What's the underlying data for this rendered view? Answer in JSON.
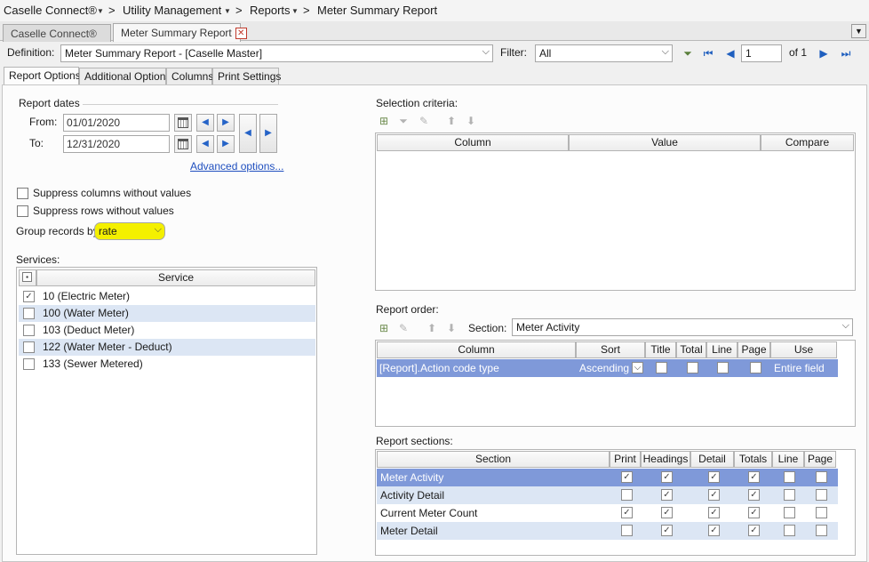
{
  "breadcrumb": {
    "items": [
      "Caselle Connect®",
      "Utility Management",
      "Reports",
      "Meter Summary Report"
    ]
  },
  "doc_tabs": [
    {
      "label": "Caselle Connect®"
    },
    {
      "label": "Meter Summary Report"
    }
  ],
  "definition": {
    "label": "Definition:",
    "value": "Meter Summary Report - [Caselle Master]",
    "filter_label": "Filter:",
    "filter_value": "All",
    "page_value": "1",
    "page_of": "of 1"
  },
  "page_tabs": [
    "Report Options",
    "Additional Options",
    "Columns",
    "Print Settings"
  ],
  "report_dates": {
    "title": "Report dates",
    "from_label": "From:",
    "from_value": "01/01/2020",
    "to_label": "To:",
    "to_value": "12/31/2020",
    "advanced_link": "Advanced options..."
  },
  "options": {
    "suppress_columns": "Suppress columns without values",
    "suppress_rows": "Suppress rows without values",
    "group_label": "Group records by",
    "group_value": "rate"
  },
  "services": {
    "title": "Services:",
    "header": "Service",
    "items": [
      {
        "label": "10 (Electric Meter)",
        "checked": true
      },
      {
        "label": "100 (Water Meter)",
        "checked": false
      },
      {
        "label": "103 (Deduct Meter)",
        "checked": false
      },
      {
        "label": "122 (Water Meter - Deduct)",
        "checked": false
      },
      {
        "label": "133 (Sewer Metered)",
        "checked": false
      }
    ]
  },
  "selection_criteria": {
    "title": "Selection criteria:",
    "columns": [
      "Column",
      "Value",
      "Compare"
    ]
  },
  "report_order": {
    "title": "Report order:",
    "section_label": "Section:",
    "section_value": "Meter Activity",
    "columns": [
      "Column",
      "Sort",
      "Title",
      "Total",
      "Line",
      "Page",
      "Use"
    ],
    "rows": [
      {
        "column": "[Report].Action code type",
        "sort": "Ascending",
        "use": "Entire field"
      }
    ]
  },
  "report_sections": {
    "title": "Report sections:",
    "columns": [
      "Section",
      "Print",
      "Headings",
      "Detail",
      "Totals",
      "Line",
      "Page"
    ],
    "rows": [
      {
        "section": "Meter Activity",
        "print": true,
        "headings": true,
        "detail": true,
        "totals": true,
        "line": false,
        "page": false
      },
      {
        "section": "Activity Detail",
        "print": false,
        "headings": true,
        "detail": true,
        "totals": true,
        "line": false,
        "page": false
      },
      {
        "section": "Current Meter Count",
        "print": true,
        "headings": true,
        "detail": true,
        "totals": true,
        "line": false,
        "page": false
      },
      {
        "section": "Meter Detail",
        "print": false,
        "headings": true,
        "detail": true,
        "totals": true,
        "line": false,
        "page": false
      }
    ]
  },
  "colors": {
    "selected_row": "#7f99d9",
    "alt_row": "#dce6f4",
    "highlight": "#f4f000",
    "link": "#1f4fbf"
  }
}
